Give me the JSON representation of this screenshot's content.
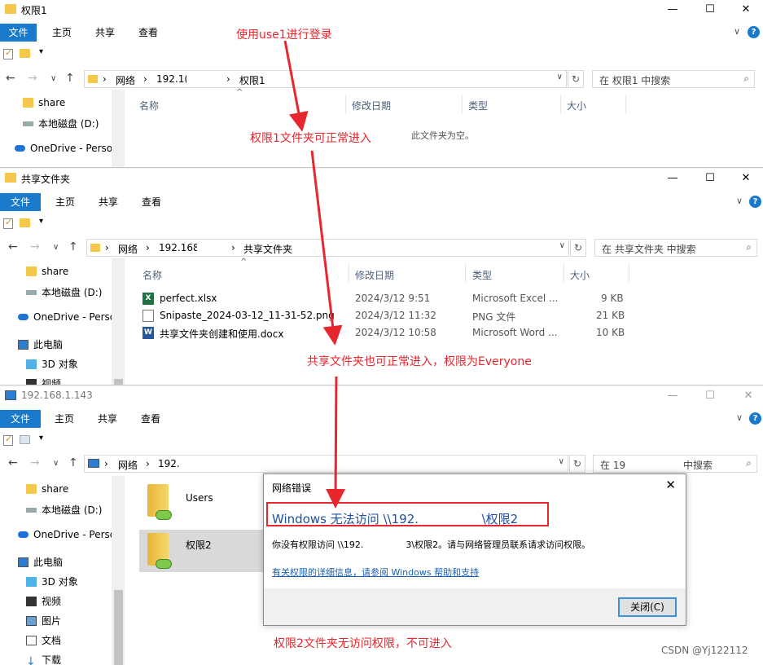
{
  "window1": {
    "title": "权限1",
    "tabs": {
      "file": "文件",
      "home": "主页",
      "share": "共享",
      "view": "查看"
    },
    "address": {
      "network": "网络",
      "host": "192.1(",
      "folder": "权限1"
    },
    "search_placeholder": "在 权限1 中搜索",
    "sidebar": [
      {
        "label": "share",
        "icon": "folder-icon"
      },
      {
        "label": "本地磁盘 (D:)",
        "icon": "drive-icon"
      },
      {
        "label": "OneDrive - Perso",
        "icon": "onedrive-icon"
      }
    ],
    "columns": {
      "name": "名称",
      "modified": "修改日期",
      "type": "类型",
      "size": "大小"
    },
    "empty_text": "此文件夹为空。"
  },
  "window2": {
    "title": "共享文件夹",
    "tabs": {
      "file": "文件",
      "home": "主页",
      "share": "共享",
      "view": "查看"
    },
    "address": {
      "network": "网络",
      "host": "192.168",
      "folder": "共享文件夹"
    },
    "search_placeholder": "在 共享文件夹 中搜索",
    "sidebar": [
      {
        "label": "share",
        "icon": "folder-icon"
      },
      {
        "label": "本地磁盘 (D:)",
        "icon": "drive-icon"
      },
      {
        "label": "OneDrive - Perso",
        "icon": "onedrive-icon"
      },
      {
        "label": "此电脑",
        "icon": "computer-icon"
      },
      {
        "label": "3D 对象",
        "icon": "3d-objects-icon"
      },
      {
        "label": "视频",
        "icon": "video-icon"
      }
    ],
    "columns": {
      "name": "名称",
      "modified": "修改日期",
      "type": "类型",
      "size": "大小"
    },
    "files": [
      {
        "name": "perfect.xlsx",
        "modified": "2024/3/12 9:51",
        "type": "Microsoft Excel ...",
        "size": "9 KB",
        "icon": "excel-file-icon"
      },
      {
        "name": "Snipaste_2024-03-12_11-31-52.png",
        "modified": "2024/3/12 11:32",
        "type": "PNG 文件",
        "size": "21 KB",
        "icon": "png-file-icon"
      },
      {
        "name": "共享文件夹创建和使用.docx",
        "modified": "2024/3/12 10:58",
        "type": "Microsoft Word ...",
        "size": "10 KB",
        "icon": "word-file-icon"
      }
    ]
  },
  "window3": {
    "title": "192.168.1.143",
    "tabs": {
      "file": "文件",
      "home": "主页",
      "share": "共享",
      "view": "查看"
    },
    "address": {
      "network": "网络",
      "host": "192."
    },
    "search_placeholder_left": "在 19",
    "search_placeholder_right": "中搜索",
    "sidebar": [
      {
        "label": "share",
        "icon": "folder-icon"
      },
      {
        "label": "本地磁盘 (D:)",
        "icon": "drive-icon"
      },
      {
        "label": "OneDrive - Perso",
        "icon": "onedrive-icon"
      },
      {
        "label": "此电脑",
        "icon": "computer-icon"
      },
      {
        "label": "3D 对象",
        "icon": "3d-objects-icon"
      },
      {
        "label": "视频",
        "icon": "video-icon"
      },
      {
        "label": "图片",
        "icon": "pictures-icon"
      },
      {
        "label": "文档",
        "icon": "documents-icon"
      },
      {
        "label": "下载",
        "icon": "downloads-icon"
      }
    ],
    "folders": [
      {
        "name": "Users"
      },
      {
        "name": "权限2"
      }
    ]
  },
  "dialog": {
    "title": "网络错误",
    "main_left": "Windows 无法访问 \\\\192.",
    "main_right": "\\权限2",
    "detail_left": "你没有权限访问 \\\\192.",
    "detail_right": "3\\权限2。请与网络管理员联系请求访问权限。",
    "link": "有关权限的详细信息，请参阅 Windows 帮助和支持",
    "close_button": "关闭(C)"
  },
  "annotations": {
    "top": "使用use1进行登录",
    "first": "权限1文件夹可正常进入",
    "second": "共享文件夹也可正常进入，权限为Everyone",
    "third": "权限2文件夹无访问权限，不可进入"
  },
  "watermark": "CSDN @Yj122112",
  "colors": {
    "accent": "#1979ca",
    "annotation": "#e8262d",
    "link": "#1a5fb4"
  }
}
